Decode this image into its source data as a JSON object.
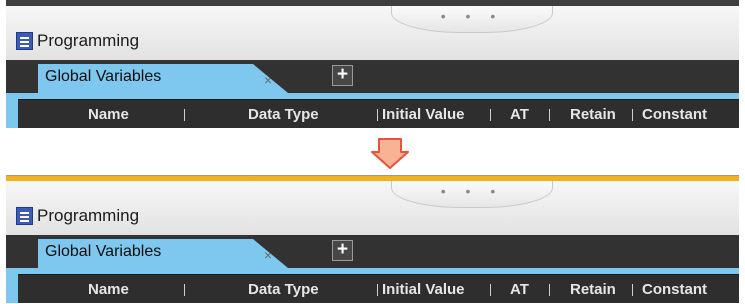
{
  "panel": {
    "title": "Programming",
    "grip_dots": "• • •"
  },
  "tabs": {
    "active_label": "Global Variables",
    "close_glyph": "×",
    "add_glyph": "+"
  },
  "grid": {
    "columns": [
      "Name",
      "Data Type",
      "Initial Value",
      "AT",
      "Retain",
      "Constant"
    ]
  },
  "colors": {
    "tab_blue": "#7ec7ee",
    "dark_bar": "#323232",
    "highlight_bar": "#f0b21e",
    "arrow_fill": "#f7b394",
    "arrow_stroke": "#e8543a"
  }
}
